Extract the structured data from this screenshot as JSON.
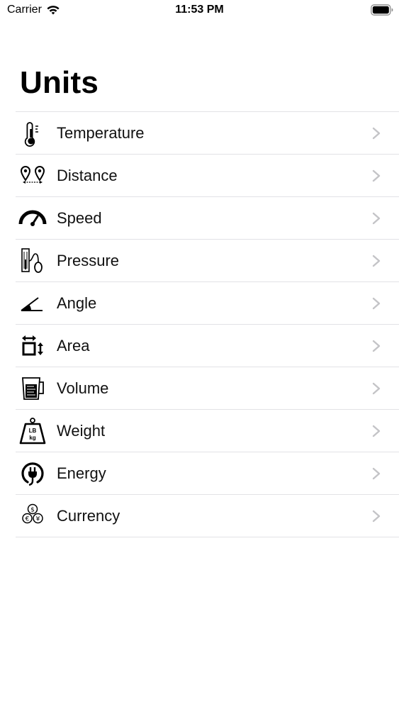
{
  "status_bar": {
    "carrier": "Carrier",
    "time": "11:53 PM",
    "wifi_icon": "wifi-icon",
    "battery_icon": "battery-icon"
  },
  "page": {
    "title": "Units"
  },
  "colors": {
    "separator": "#e2e2e6",
    "chevron": "#c4c4c7",
    "text": "#111111",
    "background": "#ffffff"
  },
  "units": [
    {
      "label": "Temperature",
      "icon": "thermometer-icon"
    },
    {
      "label": "Distance",
      "icon": "distance-pins-icon"
    },
    {
      "label": "Speed",
      "icon": "speedometer-icon"
    },
    {
      "label": "Pressure",
      "icon": "pressure-gauge-icon"
    },
    {
      "label": "Angle",
      "icon": "angle-icon"
    },
    {
      "label": "Area",
      "icon": "area-icon"
    },
    {
      "label": "Volume",
      "icon": "measuring-jug-icon"
    },
    {
      "label": "Weight",
      "icon": "weight-icon"
    },
    {
      "label": "Energy",
      "icon": "plug-icon"
    },
    {
      "label": "Currency",
      "icon": "coins-icon"
    }
  ]
}
